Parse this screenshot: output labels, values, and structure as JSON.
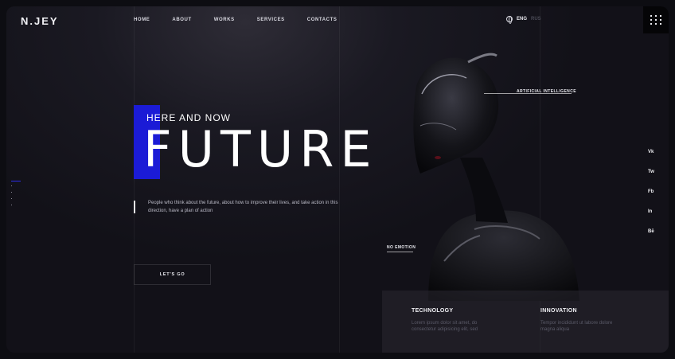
{
  "brand": {
    "logo": "N.JEY"
  },
  "nav": {
    "items": [
      "HOME",
      "ABOUT",
      "WORKS",
      "SERVICES",
      "CONTACTS"
    ]
  },
  "lang": {
    "current": "ENG",
    "alt": "RUS"
  },
  "hero": {
    "kicker": "HERE AND NOW",
    "headline": "FUTURE",
    "description": "People who think about the future, about how to improve their lives, and take action in this direction, have a plan of action",
    "cta": "LET'S GO"
  },
  "annotations": {
    "top": "ARTIFICIAL INTELLIGENCE",
    "bottom": "NO EMOTION"
  },
  "socials": [
    "Vk",
    "Tw",
    "Fb",
    "In",
    "Bē"
  ],
  "features": [
    {
      "title": "TECHNOLOGY",
      "text": "Lorem ipsum dolor sit amet, do consectetur adipisicing elit, sed"
    },
    {
      "title": "INNOVATION",
      "text": "Tempor incididunt ut labore dolore magna aliqua"
    }
  ],
  "colors": {
    "accent": "#1b1bd6",
    "background": "#121118"
  }
}
